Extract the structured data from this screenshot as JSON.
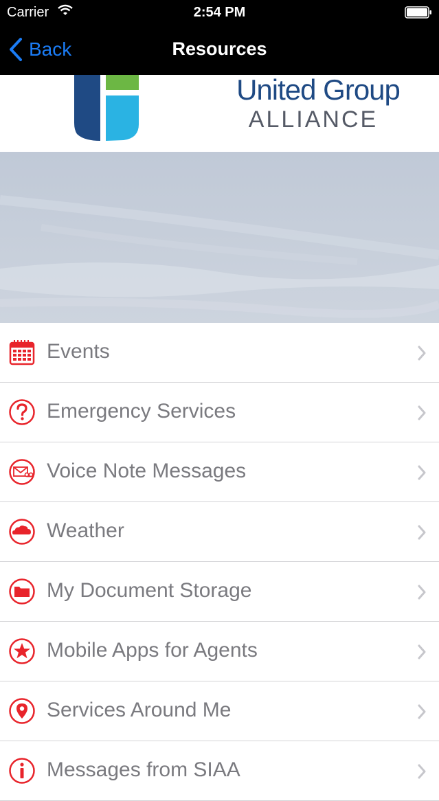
{
  "status_bar": {
    "carrier": "Carrier",
    "time": "2:54 PM"
  },
  "nav": {
    "back_label": "Back",
    "title": "Resources"
  },
  "logo": {
    "line1": "United Group",
    "line2": "ALLIANCE"
  },
  "colors": {
    "accent_red": "#e8242b",
    "ios_blue": "#1b7cf5",
    "logo_navy": "#1f4a84",
    "logo_green": "#6cb744",
    "logo_cyan": "#2ab3e3"
  },
  "menu": [
    {
      "label": "Events",
      "icon": "calendar-icon"
    },
    {
      "label": "Emergency Services",
      "icon": "question-icon"
    },
    {
      "label": "Voice Note Messages",
      "icon": "voicemail-icon"
    },
    {
      "label": "Weather",
      "icon": "cloud-icon"
    },
    {
      "label": "My Document Storage",
      "icon": "folder-icon"
    },
    {
      "label": "Mobile Apps for Agents",
      "icon": "star-icon"
    },
    {
      "label": "Services Around Me",
      "icon": "location-pin-icon"
    },
    {
      "label": "Messages from SIAA",
      "icon": "info-icon"
    }
  ]
}
